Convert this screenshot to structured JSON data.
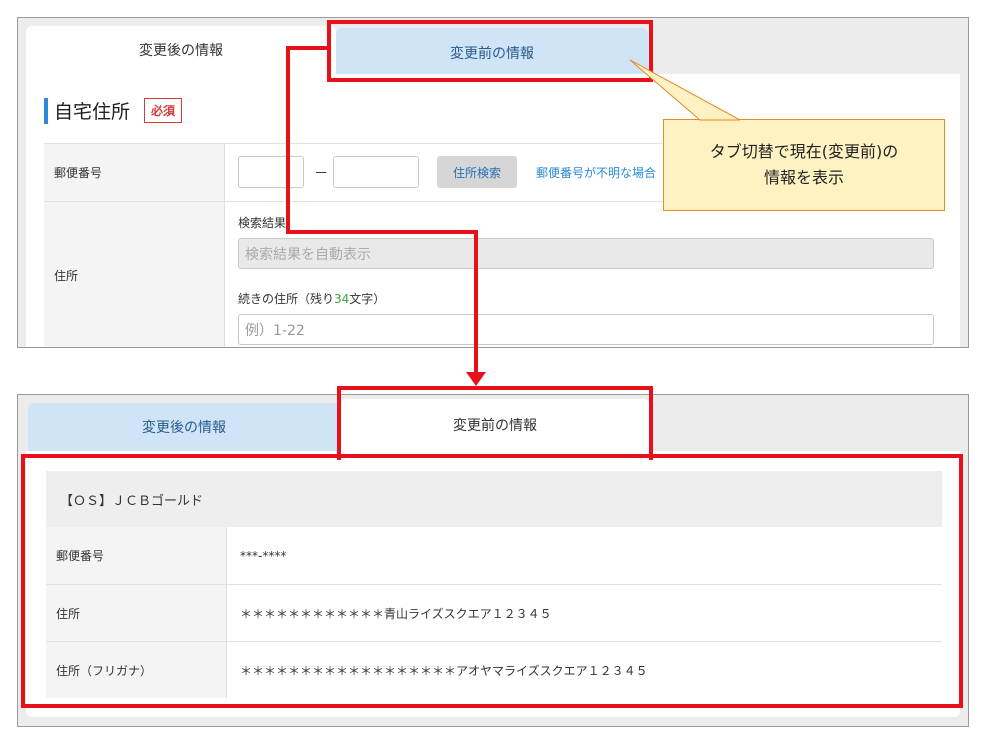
{
  "top": {
    "tabs": [
      {
        "label": "変更後の情報",
        "active": true
      },
      {
        "label": "変更前の情報",
        "active": false
      }
    ],
    "section_title": "自宅住所",
    "required_badge": "必須",
    "postal": {
      "label": "郵便番号",
      "dash": "－",
      "search_button": "住所検索",
      "unknown_link": "郵便番号が不明な場合"
    },
    "address": {
      "label": "住所",
      "search_result_label": "検索結果",
      "search_result_placeholder": "検索結果を自動表示",
      "continued_label_prefix": "続きの住所（残り",
      "continued_remaining": "34",
      "continued_label_suffix": "文字）",
      "continued_placeholder": "例）1-22"
    }
  },
  "callout": {
    "line1": "タブ切替で現在(変更前)の",
    "line2": "情報を表示"
  },
  "bottom": {
    "tabs": [
      {
        "label": "変更後の情報",
        "active": false
      },
      {
        "label": "変更前の情報",
        "active": true
      }
    ],
    "card_title": "【ＯＳ】ＪＣＢゴールド",
    "rows": [
      {
        "label": "郵便番号",
        "value": "***-****"
      },
      {
        "label": "住所",
        "value": "＊＊＊＊＊＊＊＊＊＊＊＊青山ライズスクエア１２３４５"
      },
      {
        "label": "住所（フリガナ）",
        "value": "＊＊＊＊＊＊＊＊＊＊＊＊＊＊＊＊＊＊アオヤマライズスクエア１２３４５"
      }
    ]
  },
  "colors": {
    "highlight_red": "#e8101a",
    "accent_blue": "#2a8ad8",
    "inactive_tab": "#cfe4f7",
    "callout_fill": "#fff2c2",
    "callout_border": "#e48a27"
  }
}
